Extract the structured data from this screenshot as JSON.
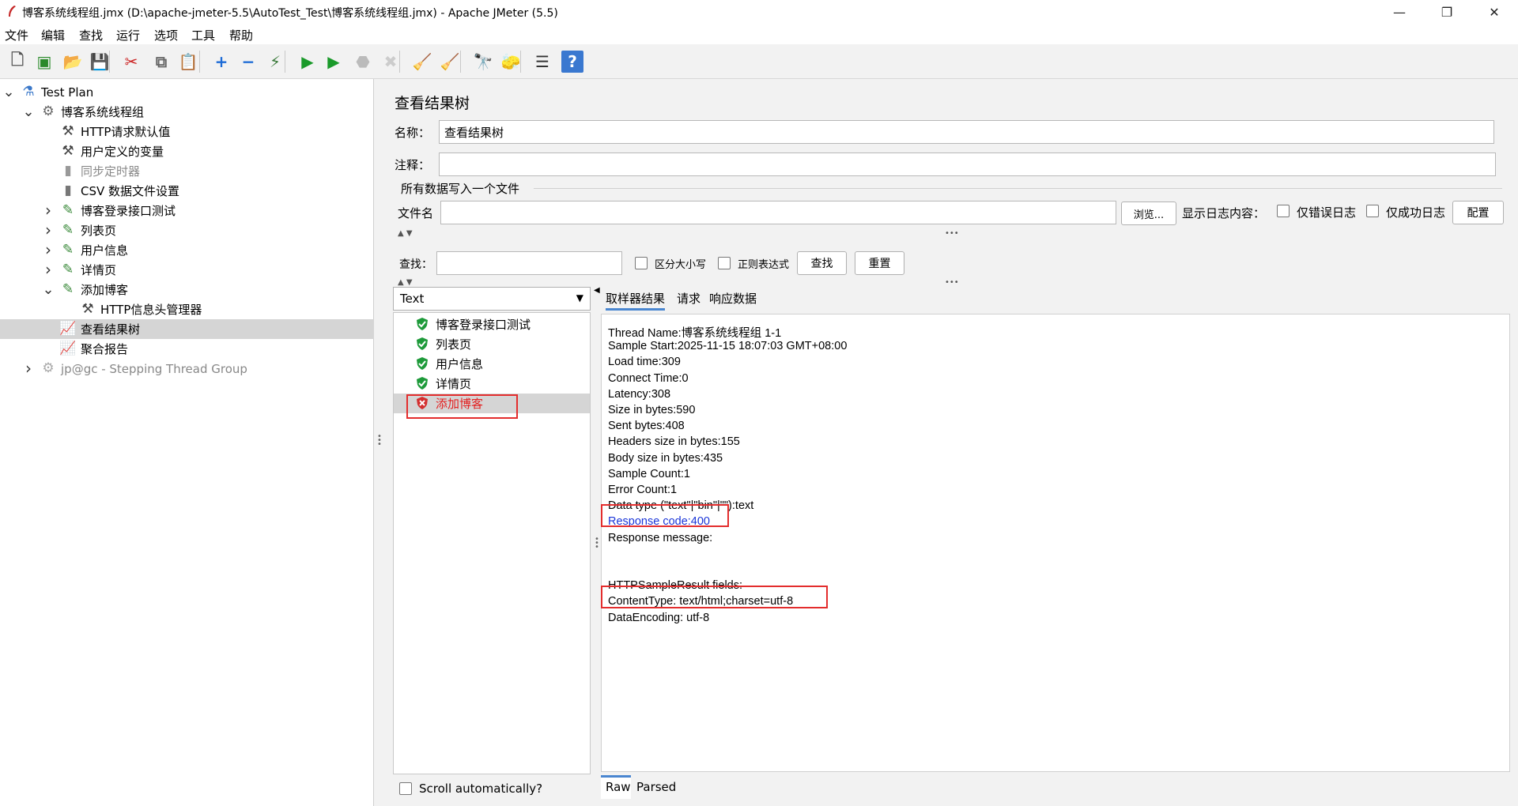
{
  "window": {
    "title": "博客系统线程组.jmx (D:\\apache-jmeter-5.5\\AutoTest_Test\\博客系统线程组.jmx) - Apache JMeter (5.5)",
    "minimize": "—",
    "restore": "❐",
    "close": "✕"
  },
  "menu": [
    "文件",
    "编辑",
    "查找",
    "运行",
    "选项",
    "工具",
    "帮助"
  ],
  "toolbar": [
    {
      "name": "new-icon",
      "glyph": "🗋",
      "color": "#555"
    },
    {
      "name": "templates-icon",
      "glyph": "▣",
      "color": "#2a8a2a"
    },
    {
      "name": "open-icon",
      "glyph": "📂",
      "color": "#d49a18"
    },
    {
      "name": "save-icon",
      "glyph": "💾",
      "color": "#333"
    },
    {
      "name": "cut-icon",
      "glyph": "✂",
      "color": "#c22"
    },
    {
      "name": "copy-icon",
      "glyph": "⧉",
      "color": "#666"
    },
    {
      "name": "paste-icon",
      "glyph": "📋",
      "color": "#a07020"
    },
    {
      "name": "expand-icon",
      "glyph": "+",
      "color": "#1d6bd6"
    },
    {
      "name": "collapse-icon",
      "glyph": "−",
      "color": "#1d6bd6"
    },
    {
      "name": "toggle-icon",
      "glyph": "⚡",
      "color": "#3a7a3a"
    },
    {
      "name": "start-icon",
      "glyph": "▶",
      "color": "#1a9a2a"
    },
    {
      "name": "start-no-pauses-icon",
      "glyph": "▶",
      "color": "#1a9a2a"
    },
    {
      "name": "stop-icon",
      "glyph": "⬣",
      "color": "#bbb"
    },
    {
      "name": "shutdown-icon",
      "glyph": "✖",
      "color": "#ccc"
    },
    {
      "name": "clear-icon",
      "glyph": "🧹",
      "color": "#8a6a3a"
    },
    {
      "name": "clear-all-icon",
      "glyph": "🧹",
      "color": "#8a6a3a"
    },
    {
      "name": "search-icon",
      "glyph": "🔭",
      "color": "#222"
    },
    {
      "name": "reset-search-icon",
      "glyph": "🧽",
      "color": "#d6a820"
    },
    {
      "name": "function-helper-icon",
      "glyph": "☰",
      "color": "#333"
    },
    {
      "name": "help-icon",
      "glyph": "?",
      "color": "#fff"
    }
  ],
  "tree": [
    {
      "label": "Test Plan",
      "level": 0,
      "expander": "v",
      "icon": "flask-icon",
      "color": "#3b78c9"
    },
    {
      "label": "博客系统线程组",
      "level": 1,
      "expander": "v",
      "icon": "gear-icon",
      "color": "#666"
    },
    {
      "label": "HTTP请求默认值",
      "level": 2,
      "expander": "",
      "icon": "tools-icon",
      "color": "#444"
    },
    {
      "label": "用户定义的变量",
      "level": 2,
      "expander": "",
      "icon": "tools-icon",
      "color": "#444"
    },
    {
      "label": "同步定时器",
      "level": 2,
      "expander": "",
      "icon": "timer-icon",
      "color": "#999",
      "disabled": true
    },
    {
      "label": "CSV 数据文件设置",
      "level": 2,
      "expander": "",
      "icon": "file-icon",
      "color": "#777"
    },
    {
      "label": "博客登录接口测试",
      "level": 2,
      "expander": ">",
      "icon": "pipette-icon",
      "color": "#3a8a3a"
    },
    {
      "label": "列表页",
      "level": 2,
      "expander": ">",
      "icon": "pipette-icon",
      "color": "#3a8a3a"
    },
    {
      "label": "用户信息",
      "level": 2,
      "expander": ">",
      "icon": "pipette-icon",
      "color": "#3a8a3a"
    },
    {
      "label": "详情页",
      "level": 2,
      "expander": ">",
      "icon": "pipette-icon",
      "color": "#3a8a3a"
    },
    {
      "label": "添加博客",
      "level": 2,
      "expander": "v",
      "icon": "pipette-icon",
      "color": "#3a8a3a"
    },
    {
      "label": "HTTP信息头管理器",
      "level": 3,
      "expander": "",
      "icon": "tools-icon",
      "color": "#444"
    },
    {
      "label": "查看结果树",
      "level": 2,
      "expander": "",
      "icon": "chart-icon",
      "color": "#9a3aa8",
      "selected": true
    },
    {
      "label": "聚合报告",
      "level": 2,
      "expander": "",
      "icon": "chart-icon",
      "color": "#9a3aa8"
    },
    {
      "label": "jp@gc - Stepping Thread Group",
      "level": 1,
      "expander": ">",
      "icon": "gear-icon",
      "color": "#aaa",
      "disabled": true
    }
  ],
  "panel": {
    "title": "查看结果树",
    "name_label": "名称：",
    "name_value": "查看结果树",
    "comment_label": "注释：",
    "comment_value": "",
    "file_section": "所有数据写入一个文件",
    "filename_label": "文件名",
    "filename_value": "",
    "browse": "浏览...",
    "log_label": "显示日志内容：",
    "errors_only": "仅错误日志",
    "success_only": "仅成功日志",
    "configure": "配置",
    "search_label": "查找：",
    "search_value": "",
    "case_sensitive": "区分大小写",
    "regex": "正则表达式",
    "find": "查找",
    "reset": "重置",
    "renderer": "Text",
    "scroll_auto": "Scroll automatically?"
  },
  "samples": [
    {
      "label": "博客登录接口测试",
      "status": "success"
    },
    {
      "label": "列表页",
      "status": "success"
    },
    {
      "label": "用户信息",
      "status": "success"
    },
    {
      "label": "详情页",
      "status": "success"
    },
    {
      "label": "添加博客",
      "status": "error",
      "selected": true
    }
  ],
  "result_tabs": [
    "取样器结果",
    "请求",
    "响应数据"
  ],
  "bottom_tabs": [
    "Raw",
    "Parsed"
  ],
  "result_lines": [
    "Thread Name:博客系统线程组 1-1",
    "Sample Start:2025-11-15 18:07:03 GMT+08:00",
    "Load time:309",
    "Connect Time:0",
    "Latency:308",
    "Size in bytes:590",
    "Sent bytes:408",
    "Headers size in bytes:155",
    "Body size in bytes:435",
    "Sample Count:1",
    "Error Count:1",
    "Data type (\"text\"|\"bin\"|\"\"):text",
    "Response code:400",
    "Response message:",
    "",
    "",
    "HTTPSampleResult fields:",
    "ContentType: text/html;charset=utf-8",
    "DataEncoding: utf-8"
  ],
  "colors": {
    "error_red": "#e32020",
    "success_green": "#1e9a3a",
    "link_blue": "#1a35d8",
    "highlight_box": "#e32d2d",
    "selected_row": "#d5d5d5"
  }
}
